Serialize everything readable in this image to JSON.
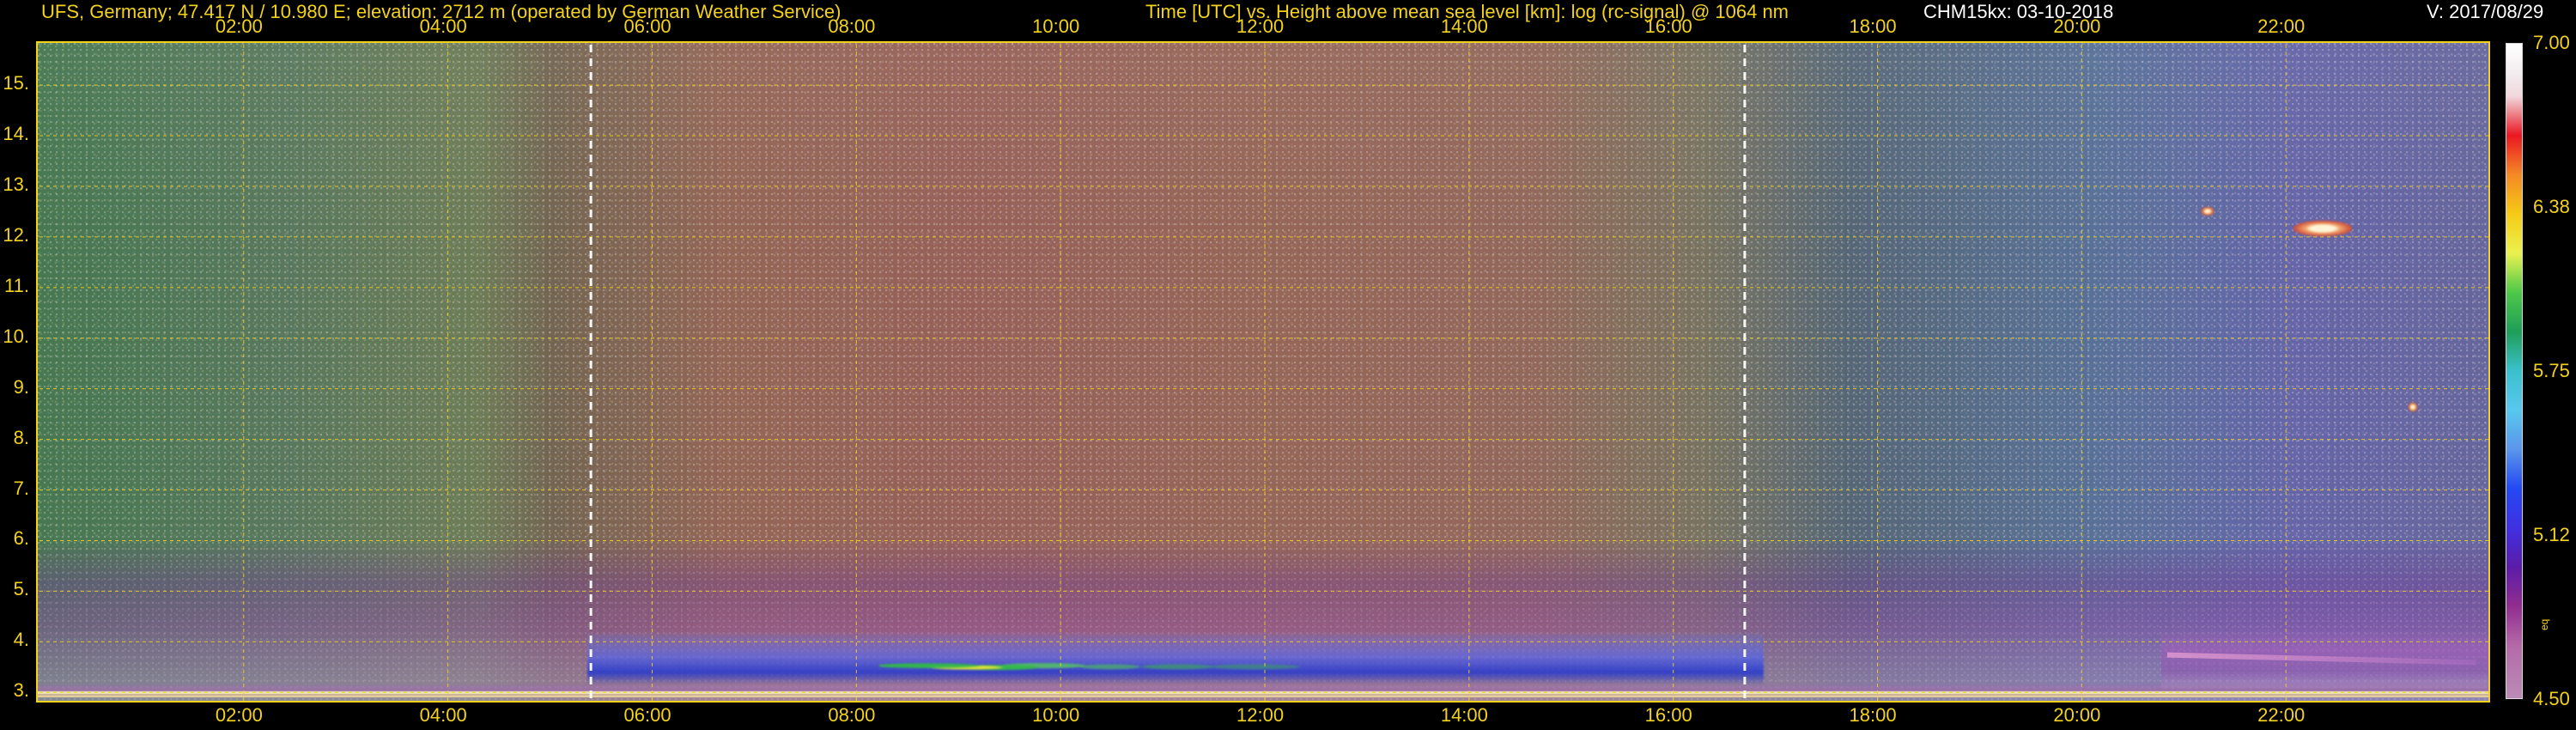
{
  "header": {
    "station": "UFS, Germany; 47.417 N / 10.980 E; elevation: 2712 m  (operated by German Weather Service)",
    "chart_title": "Time [UTC] vs. Height above mean sea level [km]: log (rc-signal) @ 1064 nm",
    "instrument": "CHM15kx: 03-10-2018",
    "version": "V: 2017/08/29"
  },
  "colors": {
    "accent": "#f2d21b",
    "white": "#ffffff"
  },
  "colorbar": {
    "labels": [
      "7.00",
      "6.38",
      "5.75",
      "5.12",
      "4.50"
    ],
    "minor_label": "eq"
  },
  "chart_data": {
    "type": "heatmap",
    "title": "Time [UTC] vs. Height above mean sea level [km]: log (rc-signal) @ 1064 nm",
    "xlabel": "Time [UTC]",
    "ylabel": "Height above mean sea level [km]",
    "x_ticks": [
      "02:00",
      "04:00",
      "06:00",
      "08:00",
      "10:00",
      "12:00",
      "14:00",
      "16:00",
      "18:00",
      "20:00",
      "22:00"
    ],
    "x_tick_values": [
      2,
      4,
      6,
      8,
      10,
      12,
      14,
      16,
      18,
      20,
      22
    ],
    "y_ticks": [
      "3.",
      "4.",
      "5.",
      "6.",
      "7.",
      "8.",
      "9.",
      "10.",
      "11.",
      "12.",
      "13.",
      "14.",
      "15."
    ],
    "y_tick_values": [
      3,
      4,
      5,
      6,
      7,
      8,
      9,
      10,
      11,
      12,
      13,
      14,
      15
    ],
    "xlim": [
      0.0,
      24.0
    ],
    "ylim": [
      2.8,
      15.8
    ],
    "grid": true,
    "legend": "right",
    "colorbar_range": [
      4.5,
      7.0
    ],
    "dashed_vertical_lines": [
      5.4,
      16.7
    ]
  }
}
